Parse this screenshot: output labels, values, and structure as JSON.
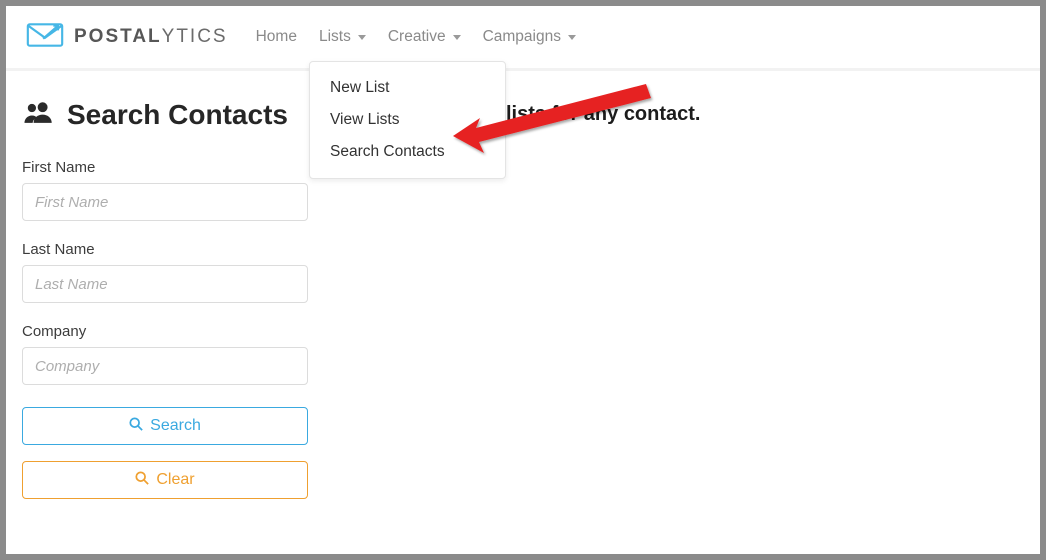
{
  "brand": {
    "strong": "POSTAL",
    "light": "YTICS"
  },
  "nav": {
    "home": "Home",
    "lists": "Lists",
    "creative": "Creative",
    "campaigns": "Campaigns"
  },
  "lists_dropdown": {
    "items": [
      {
        "label": "New List"
      },
      {
        "label": "View Lists"
      },
      {
        "label": "Search Contacts"
      }
    ]
  },
  "page": {
    "title": "Search Contacts",
    "headlinePartial": "lists for any contact."
  },
  "form": {
    "first": {
      "label": "First Name",
      "placeholder": "First Name"
    },
    "last": {
      "label": "Last Name",
      "placeholder": "Last Name"
    },
    "company": {
      "label": "Company",
      "placeholder": "Company"
    },
    "searchBtn": "Search",
    "clearBtn": "Clear"
  }
}
